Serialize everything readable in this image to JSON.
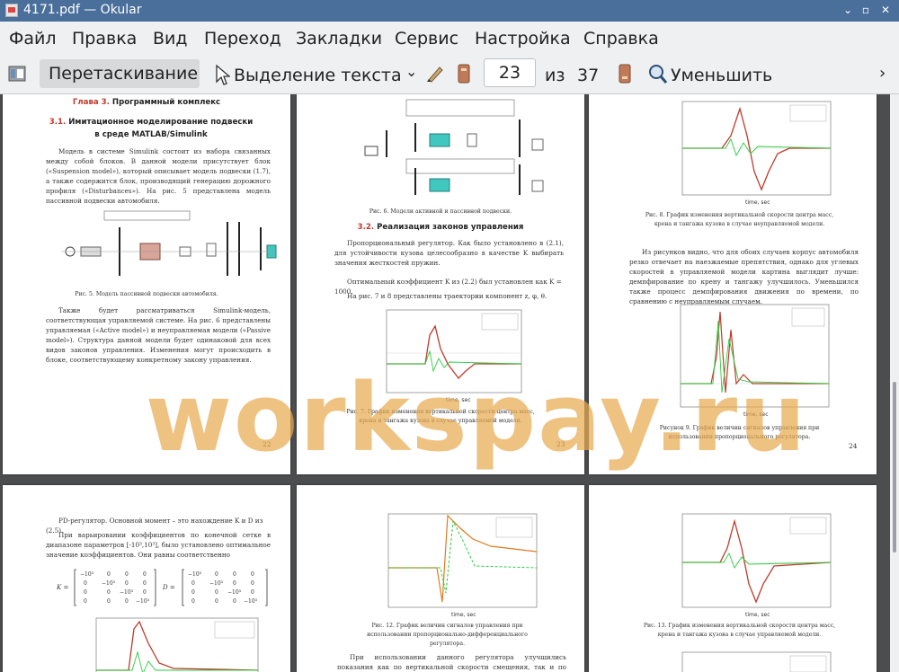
{
  "window": {
    "title": "4171.pdf  — Okular"
  },
  "menu": [
    "Файл",
    "Правка",
    "Вид",
    "Переход",
    "Закладки",
    "Сервис",
    "Настройка",
    "Справка"
  ],
  "toolbar": {
    "drag_label": "Перетаскивание",
    "select_label": "Выделение текста",
    "page_current": "23",
    "page_of": "из",
    "page_total": "37",
    "zoom_out_label": "Уменьшить"
  },
  "watermark": "workspay.ru",
  "pages": {
    "p22": {
      "chapter_red": "Глава 3.",
      "chapter_rest": " Программный комплекс",
      "section_num": "3.1.",
      "section_title": " Имитационное моделирование подвески в среде MATLAB/Simulink",
      "para1": "Модель в системе Simulink состоит из набора связанных между собой блоков. В данной модели присутствует блок («Suspension model»), который описывает модель подвески (1.7), а также содержится блок, производящий генерацию дорожного профиля («Disturbances»). На рис. 5 представлена модель пассивной подвески автомобиля.",
      "fig_caption": "Рис. 5. Модель пассивной подвески автомобиля.",
      "para2": "Также будет рассматриваться Simulink-модель, соответствующая управляемой системе. На рис. 6 представлены управляемая («Active model») и неуправляемая модели («Passive model»). Структура данной модели будет одинаковой для всех видов законов управления. Изменения могут происходить в блоке, соответствующему конкретному закону управления.",
      "number": "22"
    },
    "p23": {
      "fig6_caption": "Рис. 6. Модели активной и пассивной подвески.",
      "section_num": "3.2.",
      "section_title": " Реализация законов управления",
      "para1": "Пропорциональный регулятор. Как было установлено в (2.1), для устойчивости кузова целесообразно в качестве K выбирать значения жесткостей пружин.",
      "para2": "Оптимальный коэффициент K из (2.2) был установлен как K = 1000.",
      "para3": "На рис. 7 и 8 представлены траектории компонент z, φ, θ.",
      "fig7_caption": "Рис. 7. График изменения вертикальной скорости центра масс, крена и тангажа кузова в случае управляемой модели.",
      "number": "23",
      "plot_xlabel": "time, sec"
    },
    "p24": {
      "fig8_caption": "Рис. 8. График изменения вертикальной скорости центра масс, крена и тангажа кузова в случае неуправляемой модели.",
      "para1": "Из рисунков видно, что для обоих случаев корпус автомобиля резко отвечает на наезжаемые препятствия, однако для углевых скоростей в управляемой модели картина выглядит лучше: демпфирование по крену и тангажу улучшилось. Уменьшился также процесс демпфирования движения по времени, по сравнению с неуправляемым случаем.",
      "fig9_caption": "Рисунок 9. График величин сигналов управления при использовании пропорционального регулятора.",
      "number": "24",
      "plot_xlabel": "time, sec"
    },
    "p25": {
      "para1": "PD-регулятор. Основной момент – это нахождение K и D из (2.5).",
      "para2": "При варьировании коэффициентов по конечной сетке в диапазоне параметров [-10³,10³], было установлено оптимальное значение коэффициентов. Они равны соответственно"
    },
    "p26": {
      "fig12_caption": "Рис. 12. График величин сигналов управления при использовании пропорционально-дифференциального регулятора.",
      "para1": "При использовании данного регулятора улучшились показания как по вертикальной скорости смещения, так и по крену и тангажу. Можно",
      "plot_xlabel": "time, sec"
    },
    "p27": {
      "fig13_caption": "Рис. 13. График изменения вертикальной скорости центра масс, крена и тангажа кузова в случае управляемой модели.",
      "plot_xlabel": "time, sec"
    }
  },
  "colors": {
    "titlebar": "#4a6f9a",
    "watermark": "#e8aa50",
    "series_red": "#c0392b",
    "series_green": "#2ecc40",
    "series_orange": "#d35400"
  }
}
